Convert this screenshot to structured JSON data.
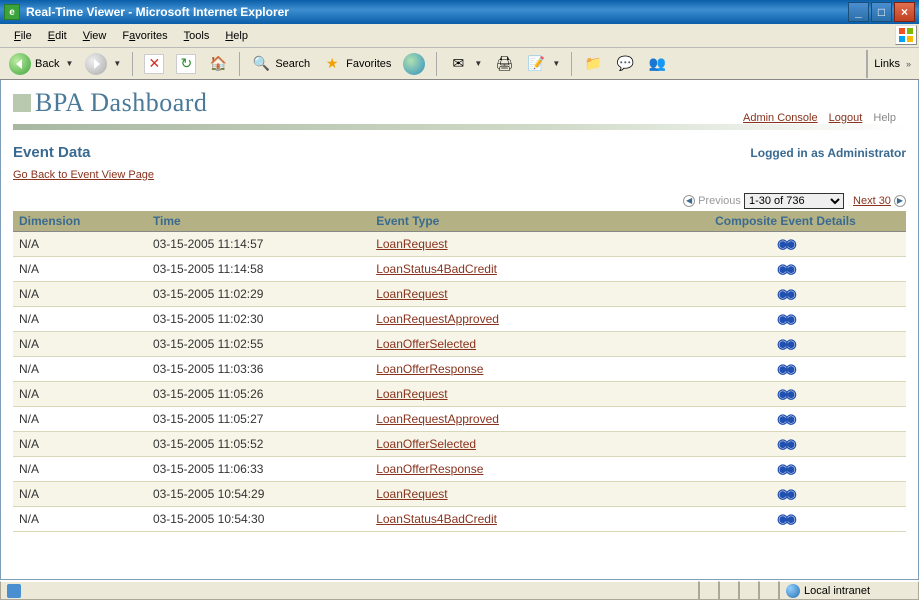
{
  "window": {
    "title": "Real-Time Viewer - Microsoft Internet Explorer"
  },
  "menubar": {
    "file": "File",
    "edit": "Edit",
    "view": "View",
    "favorites": "Favorites",
    "tools": "Tools",
    "help": "Help"
  },
  "toolbar": {
    "back": "Back",
    "search": "Search",
    "favorites": "Favorites",
    "links": "Links"
  },
  "header": {
    "logo": "BPA Dashboard",
    "admin_console": "Admin Console",
    "logout": "Logout",
    "help": "Help"
  },
  "page": {
    "title": "Event Data",
    "login_status": "Logged in as Administrator",
    "back_link": "Go Back to Event View Page"
  },
  "pager": {
    "previous": "Previous",
    "range": "1-30 of 736",
    "next": "Next 30"
  },
  "table": {
    "headers": {
      "dimension": "Dimension",
      "time": "Time",
      "event_type": "Event Type",
      "details": "Composite Event Details"
    },
    "rows": [
      {
        "dimension": "N/A",
        "time": "03-15-2005 11:14:57",
        "event_type": "LoanRequest"
      },
      {
        "dimension": "N/A",
        "time": "03-15-2005 11:14:58",
        "event_type": "LoanStatus4BadCredit"
      },
      {
        "dimension": "N/A",
        "time": "03-15-2005 11:02:29",
        "event_type": "LoanRequest"
      },
      {
        "dimension": "N/A",
        "time": "03-15-2005 11:02:30",
        "event_type": "LoanRequestApproved"
      },
      {
        "dimension": "N/A",
        "time": "03-15-2005 11:02:55",
        "event_type": "LoanOfferSelected"
      },
      {
        "dimension": "N/A",
        "time": "03-15-2005 11:03:36",
        "event_type": "LoanOfferResponse"
      },
      {
        "dimension": "N/A",
        "time": "03-15-2005 11:05:26",
        "event_type": "LoanRequest"
      },
      {
        "dimension": "N/A",
        "time": "03-15-2005 11:05:27",
        "event_type": "LoanRequestApproved"
      },
      {
        "dimension": "N/A",
        "time": "03-15-2005 11:05:52",
        "event_type": "LoanOfferSelected"
      },
      {
        "dimension": "N/A",
        "time": "03-15-2005 11:06:33",
        "event_type": "LoanOfferResponse"
      },
      {
        "dimension": "N/A",
        "time": "03-15-2005 10:54:29",
        "event_type": "LoanRequest"
      },
      {
        "dimension": "N/A",
        "time": "03-15-2005 10:54:30",
        "event_type": "LoanStatus4BadCredit"
      }
    ]
  },
  "statusbar": {
    "zone": "Local intranet"
  }
}
